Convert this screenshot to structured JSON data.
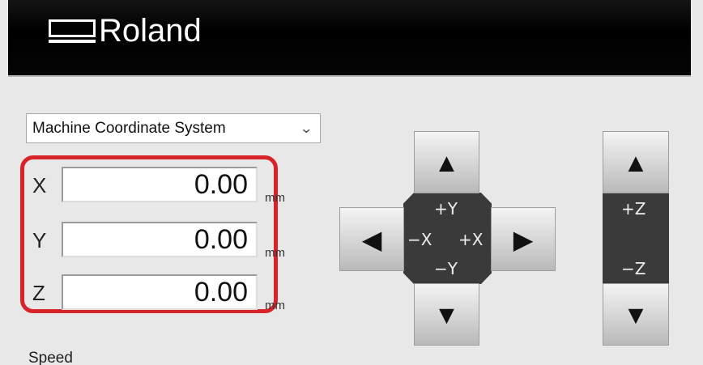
{
  "header": {
    "brand": "Roland",
    "logo_icon": "roland-logo-icon"
  },
  "coordinate_system": {
    "selected": "Machine Coordinate System"
  },
  "coordinates": [
    {
      "axis": "X",
      "value": "0.00",
      "unit": "mm"
    },
    {
      "axis": "Y",
      "value": "0.00",
      "unit": "mm"
    },
    {
      "axis": "Z",
      "value": "0.00",
      "unit": "mm"
    }
  ],
  "speed_label": "Speed",
  "xy_pad": {
    "plus_y": "+Y",
    "minus_x": "−X",
    "plus_x": "+X",
    "minus_y": "−Y"
  },
  "z_pad": {
    "plus_z": "+Z",
    "minus_z": "−Z"
  },
  "arrows": {
    "up": "▲",
    "down": "▼",
    "left": "◀",
    "right": "▶"
  },
  "colors": {
    "highlight": "#d9232b",
    "header": "#000000",
    "pad": "#3a3a3a"
  }
}
